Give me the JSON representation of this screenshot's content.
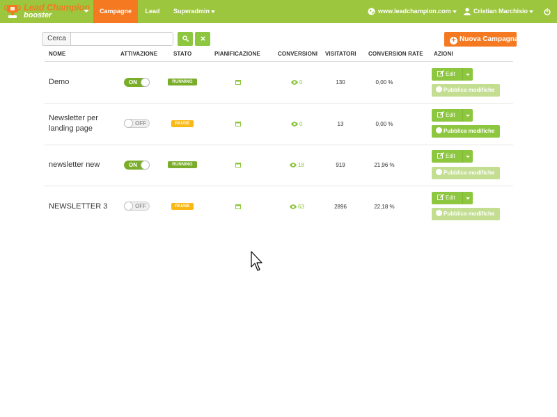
{
  "brand": {
    "line1": "Lead Champion",
    "line2": "booster"
  },
  "nav": {
    "campagne": "Campagne",
    "lead": "Lead",
    "superadmin": "Superadmin",
    "site": "www.leadchampion.com",
    "user": "Cristian Marchisio"
  },
  "toolbar": {
    "search_label": "Cerca",
    "search_value": "",
    "new_campaign": "Nuova Campagna"
  },
  "table": {
    "headers": [
      "NOME",
      "ATTIVAZIONE",
      "STATO",
      "PIANIFICAZIONE",
      "CONVERSIONI",
      "VISITATORI",
      "CONVERSION RATE",
      "AZIONI"
    ],
    "rows": [
      {
        "name": "Demo",
        "toggle": "ON",
        "status": "RUNNING",
        "conversions": "0",
        "visitors": "130",
        "rate": "0,00 %",
        "edit": "Edit",
        "publish": "Pubblica modifiche"
      },
      {
        "name": "Newsletter per landing page",
        "toggle": "OFF",
        "status": "PAUSE",
        "conversions": "0",
        "visitors": "13",
        "rate": "0,00 %",
        "edit": "Edit",
        "publish": "Pubblica modifiche"
      },
      {
        "name": "newsletter new",
        "toggle": "ON",
        "status": "RUNNING",
        "conversions": "18",
        "visitors": "919",
        "rate": "21,96 %",
        "edit": "Edit",
        "publish": "Pubblica modifiche"
      },
      {
        "name": "NEWSLETTER 3",
        "toggle": "OFF",
        "status": "PAUSE",
        "conversions": "63",
        "visitors": "2896",
        "rate": "22,18 %",
        "edit": "Edit",
        "publish": "Pubblica modifiche"
      }
    ]
  },
  "colors": {
    "navbar": "#9dc63f",
    "accent": "#f47920",
    "button_green": "#8dc63f",
    "running": "#7aad2a",
    "pause": "#f9b816"
  }
}
